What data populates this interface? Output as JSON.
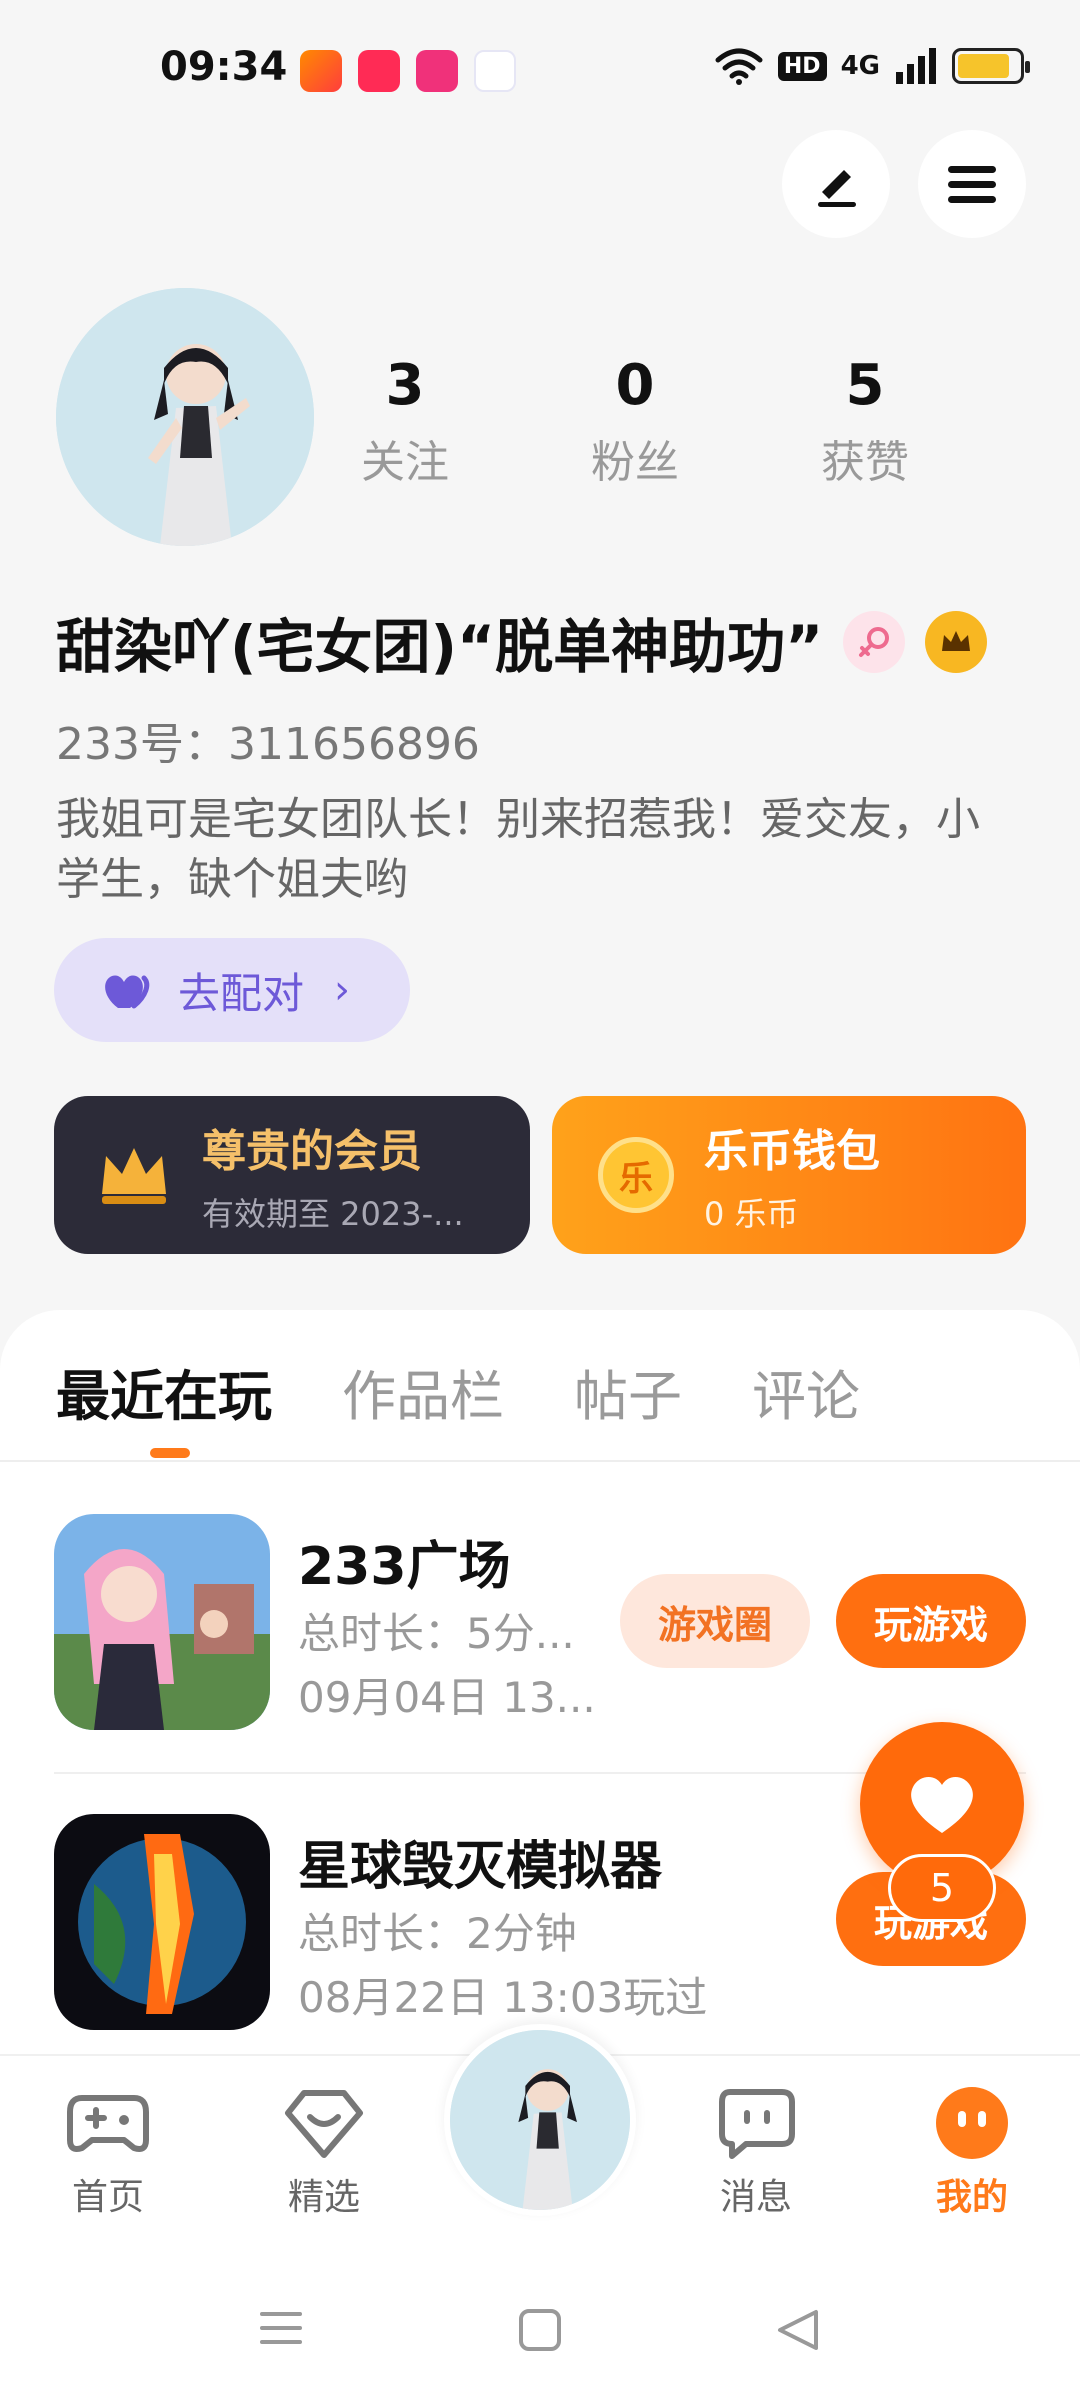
{
  "status_bar": {
    "time": "09:34",
    "hd": "HD",
    "network": "4G",
    "battery_level": 0.85,
    "app_icons": [
      "kuaishou-icon",
      "video-icon",
      "vipshop-icon",
      "baidu-icon"
    ]
  },
  "header": {
    "edit_icon": "pen-icon",
    "menu_icon": "menu-icon"
  },
  "profile": {
    "stats": [
      {
        "value": "3",
        "label": "关注"
      },
      {
        "value": "0",
        "label": "粉丝"
      },
      {
        "value": "5",
        "label": "获赞"
      }
    ],
    "nickname": "甜染吖(宅女团)“脱单神助功”",
    "uid": "233号：311656896",
    "bio": "我姐可是宅女团队长！别来招惹我！爱交友，小学生，缺个姐夫哟",
    "match_button": "去配对"
  },
  "cards": {
    "vip": {
      "title": "尊贵的会员",
      "subtitle": "有效期至 2023-..."
    },
    "wallet": {
      "title": "乐币钱包",
      "subtitle": "0 乐币",
      "coin_char": "乐"
    }
  },
  "tabs": [
    "最近在玩",
    "作品栏",
    "帖子",
    "评论"
  ],
  "games": [
    {
      "title": "233广场",
      "duration": "总时长：5分...",
      "last_played": "09月04日 13...",
      "circle_label": "游戏圈",
      "play_label": "玩游戏"
    },
    {
      "title": "星球毁灭模拟器",
      "duration": "总时长：2分钟",
      "last_played": "08月22日 13:03玩过",
      "play_label": "玩游戏"
    }
  ],
  "like_fab": {
    "count": "5"
  },
  "bottom_nav": [
    {
      "label": "首页",
      "icon": "gamepad-icon"
    },
    {
      "label": "精选",
      "icon": "heart-badge-icon"
    },
    {
      "label": "消息",
      "icon": "chat-icon"
    },
    {
      "label": "我的",
      "icon": "face-icon"
    }
  ],
  "colors": {
    "accent": "#ff7a1a",
    "vip_card": "#2c2b38",
    "match_purple": "#6d59d8"
  }
}
